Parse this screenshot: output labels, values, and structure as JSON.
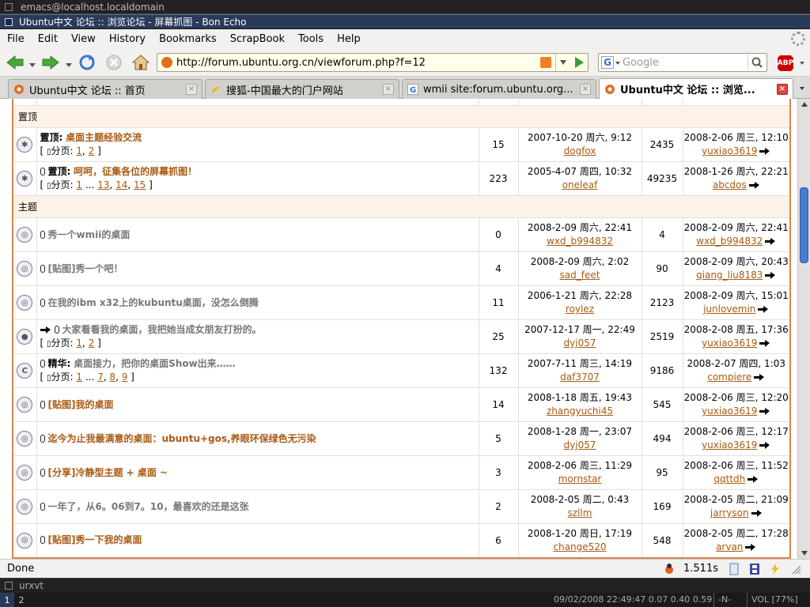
{
  "window": {
    "outer_title": "emacs@localhost.localdomain",
    "title": "Ubuntu中文 论坛 :: 浏览论坛 - 屏幕抓图 - Bon Echo"
  },
  "menu": [
    "File",
    "Edit",
    "View",
    "History",
    "Bookmarks",
    "ScrapBook",
    "Tools",
    "Help"
  ],
  "url": "http://forum.ubuntu.org.cn/viewforum.php?f=12",
  "search": {
    "placeholder": "Google",
    "engine_letter": "G"
  },
  "abp_label": "ABP",
  "tabs": [
    {
      "label": "Ubuntu中文 论坛 :: 首页",
      "active": false,
      "icon": "ubuntu-favicon"
    },
    {
      "label": "搜狐-中国最大的门户网站",
      "active": false,
      "icon": "sohu-favicon"
    },
    {
      "label": "wmii site:forum.ubuntu.org...",
      "active": false,
      "icon": "google-favicon"
    },
    {
      "label": "Ubuntu中文 论坛 :: 浏览...",
      "active": true,
      "icon": "ubuntu-favicon"
    }
  ],
  "sections": {
    "sticky": "置顶",
    "topics": "主题"
  },
  "pages_label": "分页:",
  "sticky_rows": [
    {
      "icon": "sticky-icon",
      "attach": false,
      "prefix": "置顶:",
      "title": "桌面主题经验交流",
      "bright": true,
      "pages": [
        "1",
        "2"
      ],
      "replies": "15",
      "date": "2007-10-20 周六, 9:12",
      "author": "dogfox",
      "views": "2435",
      "last_date": "2008-2-06 周三, 12:10",
      "last_user": "yuxiao3619"
    },
    {
      "icon": "sticky-icon",
      "attach": true,
      "prefix": "置顶:",
      "title": "呵呵，征集各位的屏幕抓图！",
      "bright": true,
      "pages": [
        "1",
        "...",
        "13",
        "14",
        "15"
      ],
      "replies": "223",
      "date": "2005-4-07 周四, 10:32",
      "author": "oneleaf",
      "views": "49235",
      "last_date": "2008-1-26 周六, 22:21",
      "last_user": "abcdos"
    }
  ],
  "topic_rows": [
    {
      "icon": "topic-icon",
      "attach": true,
      "prefix": "",
      "title": "秀一个wmii的桌面",
      "bright": false,
      "pages": [],
      "replies": "0",
      "date": "2008-2-09 周六, 22:41",
      "author": "wxd_b994832",
      "views": "4",
      "last_date": "2008-2-09 周六, 22:41",
      "last_user": "wxd_b994832"
    },
    {
      "icon": "topic-icon",
      "attach": true,
      "prefix": "",
      "title": "[贴图]秀一个吧！",
      "bright": false,
      "pages": [],
      "replies": "4",
      "date": "2008-2-09 周六, 2:02",
      "author": "sad_feet",
      "views": "90",
      "last_date": "2008-2-09 周六, 20:43",
      "last_user": "qiang_liu8183"
    },
    {
      "icon": "topic-icon",
      "attach": true,
      "prefix": "",
      "title": "在我的ibm x32上的kubuntu桌面，没怎么倒腾",
      "bright": false,
      "pages": [],
      "replies": "11",
      "date": "2006-1-21 周六, 22:28",
      "author": "roylez",
      "views": "2123",
      "last_date": "2008-2-09 周六, 15:01",
      "last_user": "junlovemin"
    },
    {
      "icon": "hot-topic-icon",
      "attach": true,
      "moved": true,
      "prefix": "",
      "title": "大家看看我的桌面，我把她当成女朋友打扮的。",
      "bright": false,
      "pages": [
        "1",
        "2"
      ],
      "replies": "25",
      "date": "2007-12-17 周一, 22:49",
      "author": "dyj057",
      "views": "2519",
      "last_date": "2008-2-08 周五, 17:36",
      "last_user": "yuxiao3619"
    },
    {
      "icon": "featured-icon",
      "attach": true,
      "prefix": "精华:",
      "title": "桌面接力，把你的桌面Show出来……",
      "bright": false,
      "pages": [
        "1",
        "...",
        "7",
        "8",
        "9"
      ],
      "replies": "132",
      "date": "2007-7-11 周三, 14:19",
      "author": "daf3707",
      "views": "9186",
      "last_date": "2008-2-07 周四, 1:03",
      "last_user": "compiere"
    },
    {
      "icon": "topic-icon",
      "attach": true,
      "prefix": "",
      "title": "[贴图]我的桌面",
      "bright": true,
      "pages": [],
      "replies": "14",
      "date": "2008-1-18 周五, 19:43",
      "author": "zhangyuchi45",
      "views": "545",
      "last_date": "2008-2-06 周三, 12:20",
      "last_user": "yuxiao3619"
    },
    {
      "icon": "topic-icon",
      "attach": true,
      "prefix": "",
      "title": "迄今为止我最满意的桌面：ubuntu+gos,养眼环保绿色无污染",
      "bright": true,
      "pages": [],
      "replies": "5",
      "date": "2008-1-28 周一, 23:07",
      "author": "dyj057",
      "views": "494",
      "last_date": "2008-2-06 周三, 12:17",
      "last_user": "yuxiao3619"
    },
    {
      "icon": "topic-icon",
      "attach": true,
      "prefix": "",
      "title": "[分享]冷静型主题 + 桌面 ~",
      "bright": true,
      "pages": [],
      "replies": "3",
      "date": "2008-2-06 周三, 11:29",
      "author": "mornstar",
      "views": "95",
      "last_date": "2008-2-06 周三, 11:52",
      "last_user": "qqttdh"
    },
    {
      "icon": "topic-icon",
      "attach": true,
      "prefix": "",
      "title": "一年了，从6。06到7。10，最喜欢的还是这张",
      "bright": false,
      "pages": [],
      "replies": "2",
      "date": "2008-2-05 周二, 0:43",
      "author": "szllm",
      "views": "169",
      "last_date": "2008-2-05 周二, 21:09",
      "last_user": "jarryson"
    },
    {
      "icon": "topic-icon",
      "attach": true,
      "prefix": "",
      "title": "[贴图]秀一下我的桌面",
      "bright": true,
      "pages": [],
      "replies": "6",
      "date": "2008-1-20 周日, 17:19",
      "author": "change520",
      "views": "548",
      "last_date": "2008-2-05 周二, 17:28",
      "last_user": "arvan"
    }
  ],
  "status": {
    "text": "Done",
    "timer": "1.511s"
  },
  "wm": {
    "terminal_title": "urxvt",
    "tags": [
      "1",
      "2"
    ],
    "active_tag": "1",
    "info": "09/02/2008 22:49:47 0.07 0.40 0.59",
    "mode": "-N-",
    "volume": "VOL [77%]"
  },
  "colors": {
    "accent": "#a85a12",
    "border": "#d8864a",
    "header_bg": "#fdf2e8",
    "titlebar": "#2a3a5a"
  }
}
